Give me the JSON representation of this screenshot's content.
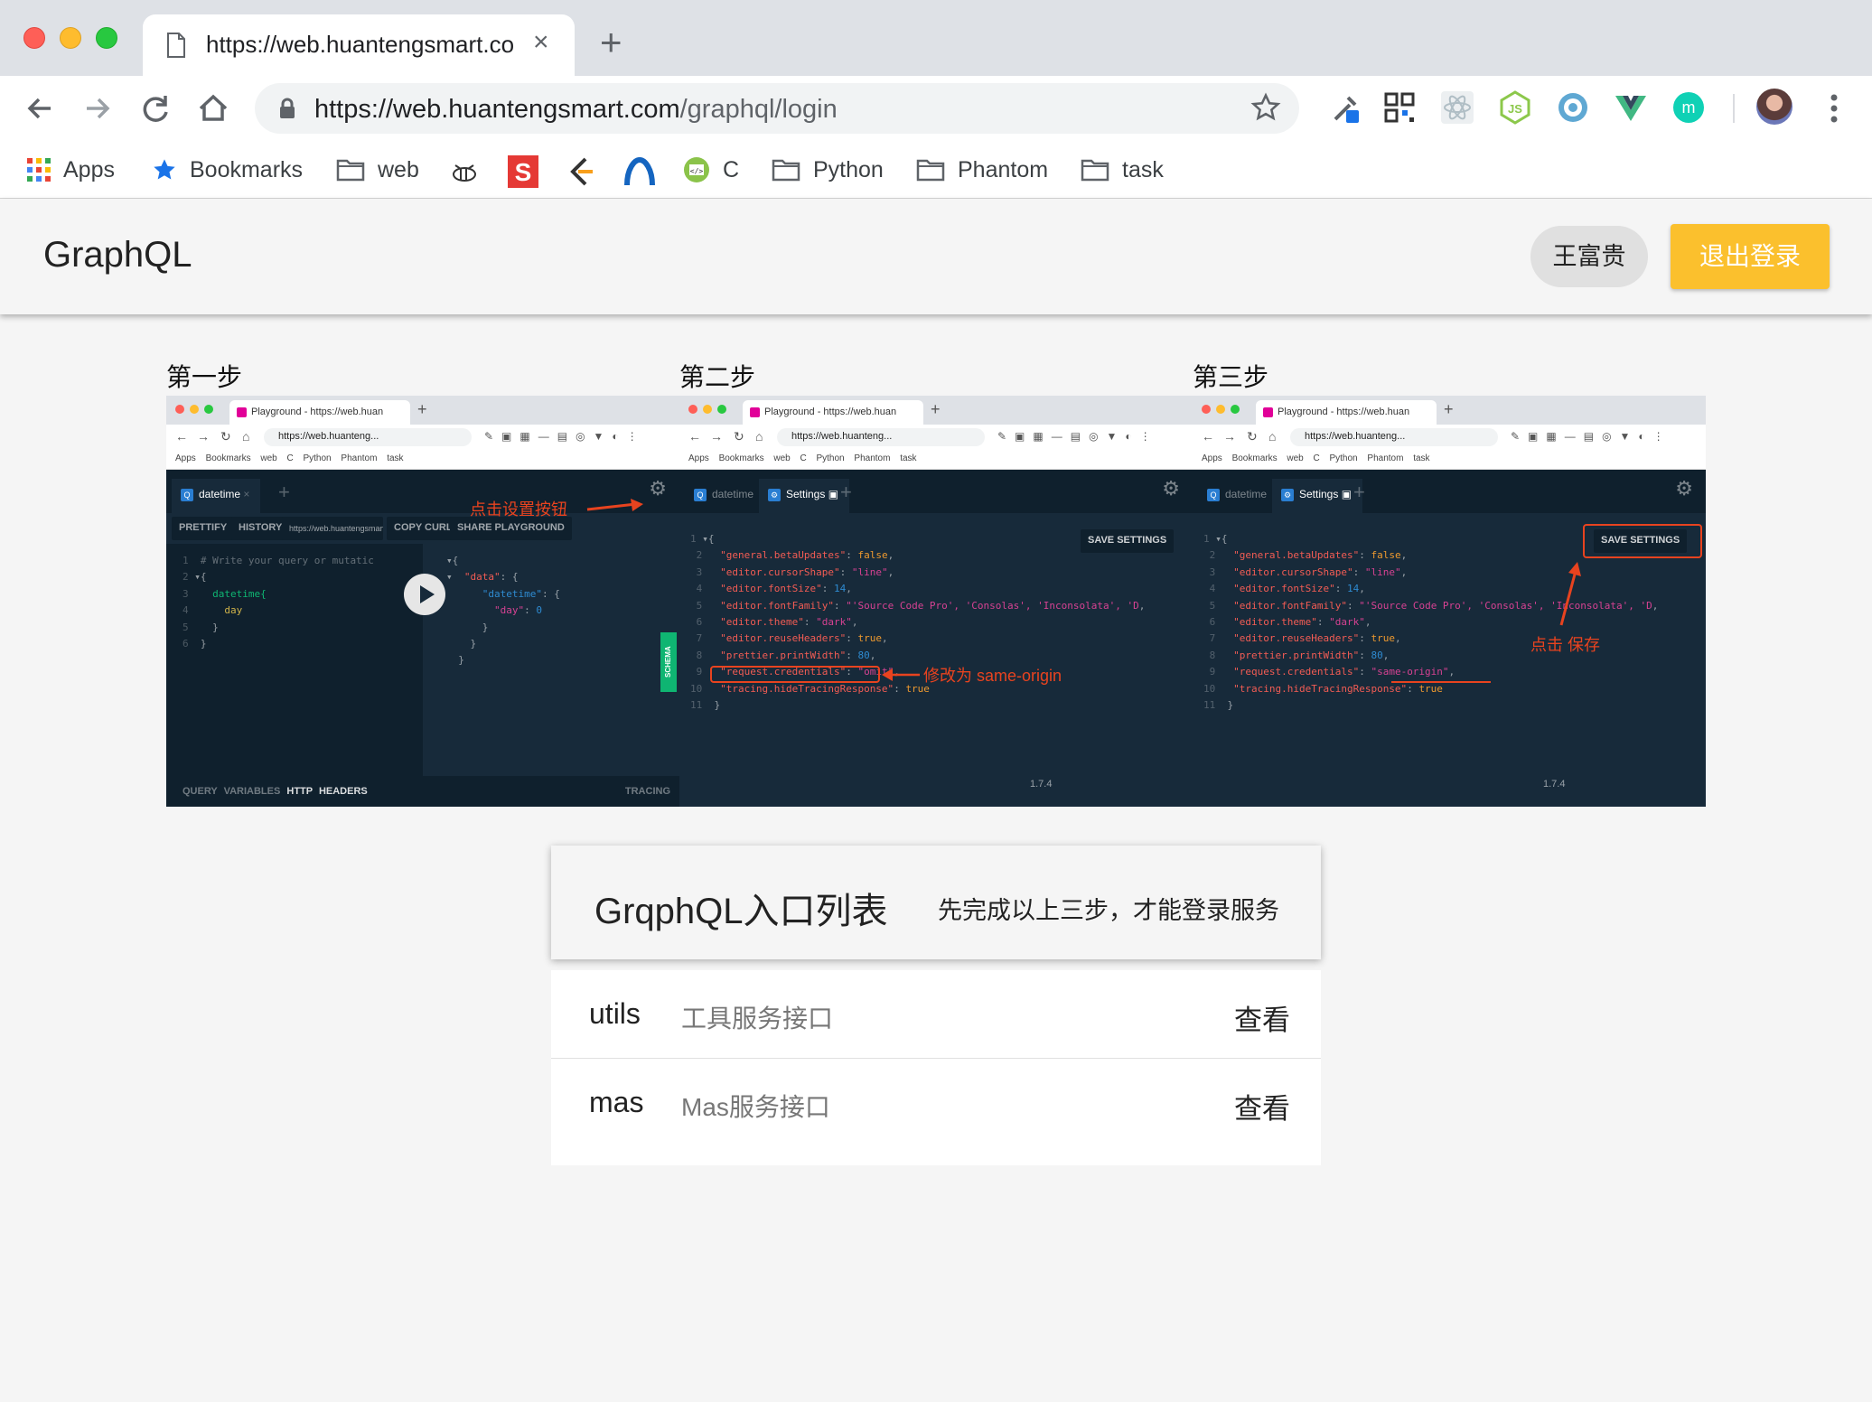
{
  "browser": {
    "tab_title": "https://web.huantengsmart.com/graphql/login",
    "url_host": "https://web.huantengsmart.com",
    "url_path": "/graphql/login",
    "bookmarks": [
      "Apps",
      "Bookmarks",
      "web",
      "C",
      "Python",
      "Phantom",
      "task"
    ]
  },
  "app": {
    "title": "GraphQL",
    "user_name": "王富贵",
    "logout_label": "退出登录",
    "accent_color": "#fbc02d"
  },
  "steps": [
    {
      "label": "第一步",
      "annotation": "点击设置按钮",
      "tab": "datetime",
      "buttons": [
        "PRETTIFY",
        "HISTORY",
        "https://web.huantengsmart.",
        "COPY CURL",
        "SHARE PLAYGROUND"
      ],
      "bottom_left": "QUERY VARIABLES",
      "bottom_mid": "HTTP HEADERS",
      "bottom_right": "TRACING",
      "schema": "SCHEMA",
      "query_comment": "# Write your query or mutatic",
      "query_field": "datetime{",
      "query_arg": "day",
      "result_key1": "\"data\"",
      "result_key2": "\"datetime\"",
      "result_key3": "\"day\"",
      "result_val": "0"
    },
    {
      "label": "第二步",
      "annotation": "修改为 same-origin",
      "tabs": [
        "datetime",
        "Settings"
      ],
      "save_label": "SAVE SETTINGS",
      "version": "1.7.4",
      "credentials_value": "\"omit\""
    },
    {
      "label": "第三步",
      "annotation": "点击 保存",
      "tabs": [
        "datetime",
        "Settings"
      ],
      "save_label": "SAVE SETTINGS",
      "version": "1.7.4",
      "credentials_value": "\"same-origin\""
    }
  ],
  "mini_browser": {
    "tab": "Playground - https://web.huan",
    "url": "https://web.huanteng...",
    "bookmarks_line": "Apps  Bookmarks  web  C  Python  Phantom  task"
  },
  "settings_lines": [
    {
      "key": "\"general.betaUpdates\"",
      "val": "false",
      "type": "bool"
    },
    {
      "key": "\"editor.cursorShape\"",
      "val": "\"line\"",
      "type": "str"
    },
    {
      "key": "\"editor.fontSize\"",
      "val": "14",
      "type": "num"
    },
    {
      "key": "\"editor.fontFamily\"",
      "val": "\"'Source Code Pro', 'Consolas', 'Inconsolata', 'D",
      "type": "str"
    },
    {
      "key": "\"editor.theme\"",
      "val": "\"dark\"",
      "type": "str"
    },
    {
      "key": "\"editor.reuseHeaders\"",
      "val": "true",
      "type": "bool"
    },
    {
      "key": "\"prettier.printWidth\"",
      "val": "80",
      "type": "num"
    },
    {
      "key": "\"request.credentials\"",
      "val": "",
      "type": "str"
    },
    {
      "key": "\"tracing.hideTracingResponse\"",
      "val": "true",
      "type": "bool"
    }
  ],
  "entry": {
    "title": "GrqphQL入口列表",
    "hint": "先完成以上三步，才能登录服务",
    "services": [
      {
        "name": "utils",
        "desc": "工具服务接口",
        "action": "查看"
      },
      {
        "name": "mas",
        "desc": "Mas服务接口",
        "action": "查看"
      }
    ]
  }
}
